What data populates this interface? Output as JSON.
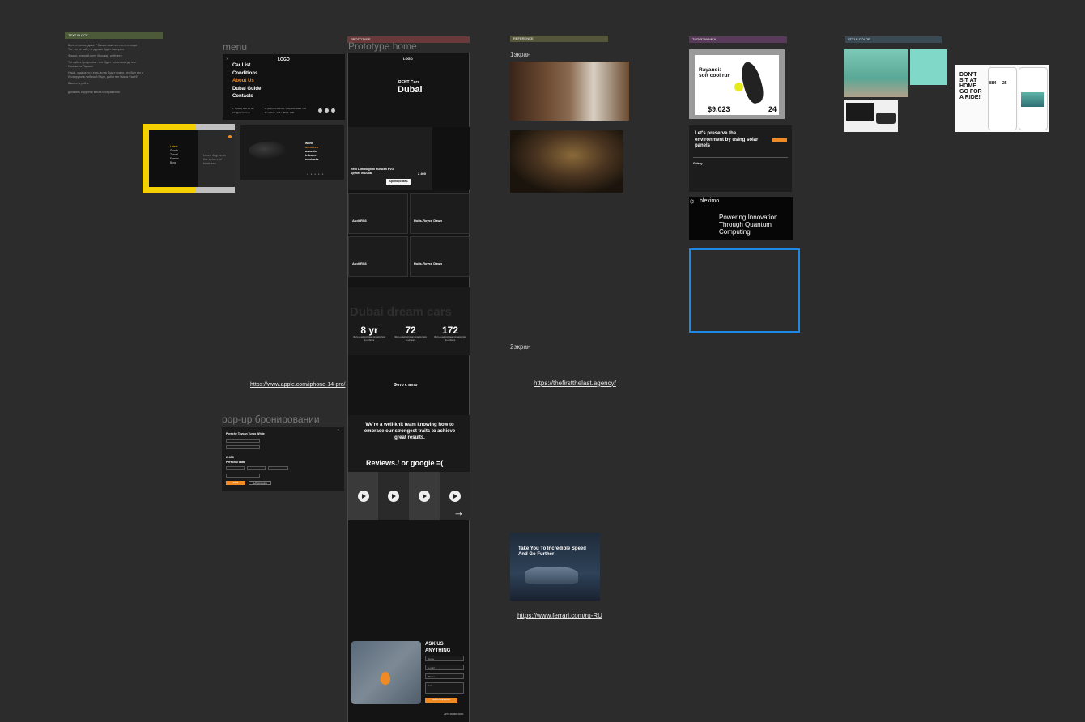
{
  "tags": {
    "textblock": "TEXT BLOCK",
    "prototype": "PROTOTYPE",
    "reference": "REFERENCE",
    "typography": "ТИПОГРАФИКА",
    "style_color": "STYLE COLOR"
  },
  "colors": {
    "canvas": "#2c2c2c",
    "accent_orange": "#f08a24",
    "accent_yellow": "#f5d000",
    "selection_blue": "#1e88e5",
    "mint": "#7fd8c8"
  },
  "notes": {
    "lines": [
      "Всем отличие, даже 7 близко кажется что-то и сюда",
      "Тот, кто не сайт, не держит будет смотреть",
      "",
      "Фишки: главный мотт, блок кар, рейтинга",
      "",
      "Тот сайт в предпочом - вот будет топчет всю да пос.",
      "Ссылка на Парсинг",
      "",
      "Наша, задача, что есть, в нас будет нужно, что был это и",
      "бронируем в любимой бюро, работ вот Никак ФастФ",
      "",
      "Вам тот с рейте",
      "",
      "",
      "добавить карусели места отображения"
    ]
  },
  "menu_frame": {
    "label": "menu",
    "logo": "LOGO",
    "items": [
      "Car List",
      "Conditions",
      "About Us",
      "Dubai Guide",
      "Contacts"
    ],
    "contact_1": "+ 7 (000) 000 00 00",
    "contact_2": "info@rentcars.ru",
    "contact_3": "+ (123) 00 000 00 / (00) 000 0000 / 00",
    "contact_4": "New York, 147 / 00/00, 000"
  },
  "yellow_frame": {
    "nav_items": [
      "Latest",
      "Sports",
      "Travel",
      "Events",
      "Blog"
    ],
    "tagline": "Learn & grow in the sphere of business",
    "right_nav": [
      "work",
      "services",
      "awards",
      "tribune",
      "contacts"
    ]
  },
  "prototype_home": {
    "label": "Prototype home",
    "logo": "LOGO",
    "hero_subtitle": "RENT Cars",
    "hero_title": "Dubai",
    "promo_text": "Rent Lamborghini Huracan EVO Spyder in Dubai",
    "promo_price": "2 400",
    "book_button": "Бронировать",
    "cars": [
      "Audi RS6",
      "Rolls-Royce Dawn",
      "Audi RS6",
      "Rolls-Royce Dawn"
    ],
    "divider_label": "Dubai dream cars",
    "big_heading": "Dubai dream cars",
    "stats": [
      {
        "value": "8 yr",
        "text": "We're a well-knit team knowing how to embrace"
      },
      {
        "value": "72",
        "text": "We're a well-knit team knowing how to embrace"
      },
      {
        "value": "172",
        "text": "We're a well-knit team knowing how to embrace"
      }
    ],
    "photo_label": "Фото с авто",
    "team_text": "We're a well-knit team knowing how to embrace our strongest traits to achieve great results.",
    "reviews_heading": "Reviews./ or google =(",
    "ask_heading": "ASK US ANYTHING",
    "form_fields": [
      "Name",
      "E-mail",
      "Phone",
      "text"
    ],
    "submit_button": "SEND A MESSAGE",
    "phone": "+971 00 000 0000"
  },
  "links": {
    "apple": "https://www.apple.com/iphone-14-pro/",
    "firstthelast": "https://thefirstthelast.agency/",
    "ferrari": "https://www.ferrari.com/ru-RU"
  },
  "popup_frame": {
    "label": "pop-up бронировании",
    "car_name": "Porsche Taycan Turbo White",
    "price": "2 400",
    "personal_data": "Personal data",
    "confirm_button": "Book",
    "cancel_button": "Выберите даты"
  },
  "references": {
    "screen1_label": "1экран",
    "screen2_label": "2экран",
    "ferrari_headline": "Take You To Incredible Speed And Go Further"
  },
  "typography_frames": {
    "rayandi_title": "Rayandi: soft cool run",
    "rayandi_price": "$9.023",
    "rayandi_number": "24",
    "solar_text": "Let's preserve the environment by using solar panels",
    "solar_sub": "Galaxy",
    "bleximo_brand": "bleximo",
    "bleximo_text": "Powering Innovation Through Quantum Computing"
  },
  "style_frames": {
    "poster_text": "DON'T SIT AT HOME. GO FOR A RIDE!",
    "stat_a": "884",
    "stat_b": "25"
  }
}
